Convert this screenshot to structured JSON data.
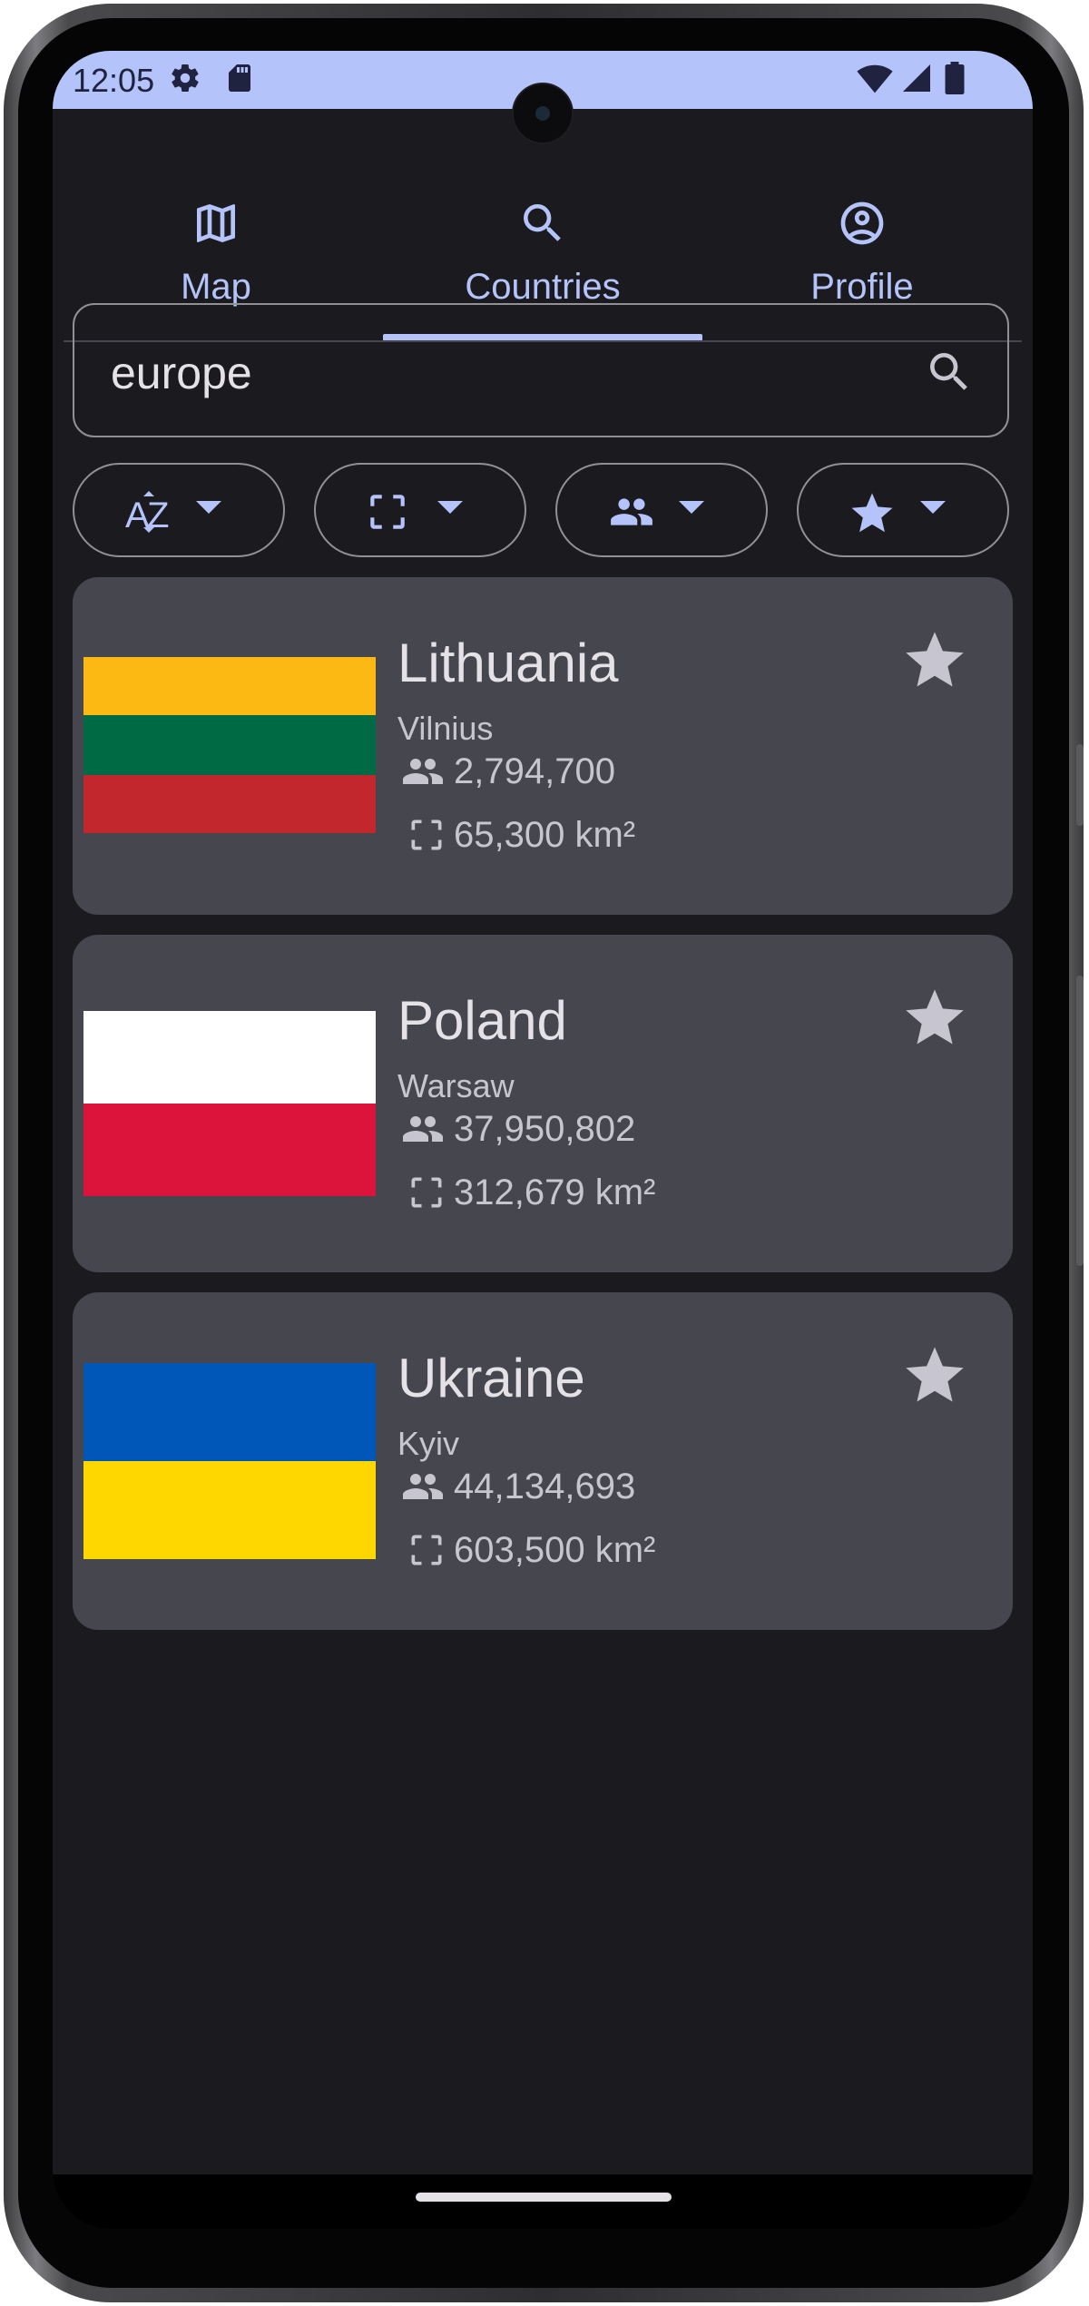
{
  "status_bar": {
    "time": "12:05",
    "icons": [
      "gear-icon",
      "sd-card-icon",
      "wifi-icon",
      "signal-icon",
      "battery-icon"
    ]
  },
  "tabs": [
    {
      "label": "Map",
      "icon": "map-icon",
      "selected": false
    },
    {
      "label": "Countries",
      "icon": "search-icon",
      "selected": true
    },
    {
      "label": "Profile",
      "icon": "account-circle-icon",
      "selected": false
    }
  ],
  "search": {
    "value": "europe",
    "icon": "search-icon"
  },
  "filters": [
    {
      "icon": "sort-az-icon"
    },
    {
      "icon": "area-icon"
    },
    {
      "icon": "population-icon"
    },
    {
      "icon": "star-icon"
    }
  ],
  "countries": [
    {
      "name": "Lithuania",
      "capital": "Vilnius",
      "population": "2,794,700",
      "area": "65,300 km²",
      "flag_colors": [
        "#fdb913",
        "#006a44",
        "#c1272d"
      ],
      "favorite": false
    },
    {
      "name": "Poland",
      "capital": "Warsaw",
      "population": "37,950,802",
      "area": "312,679 km²",
      "flag_colors": [
        "#ffffff",
        "#dc143c"
      ],
      "favorite": false
    },
    {
      "name": "Ukraine",
      "capital": "Kyiv",
      "population": "44,134,693",
      "area": "603,500 km²",
      "flag_colors": [
        "#0057b7",
        "#ffd700"
      ],
      "favorite": false
    }
  ],
  "colors": {
    "accent": "#b4c3fa",
    "background": "#1b1b1f",
    "card": "#46464f",
    "text": "#e4e2e6",
    "muted_text": "#c7c6d0",
    "star": "#c7c6d0"
  }
}
